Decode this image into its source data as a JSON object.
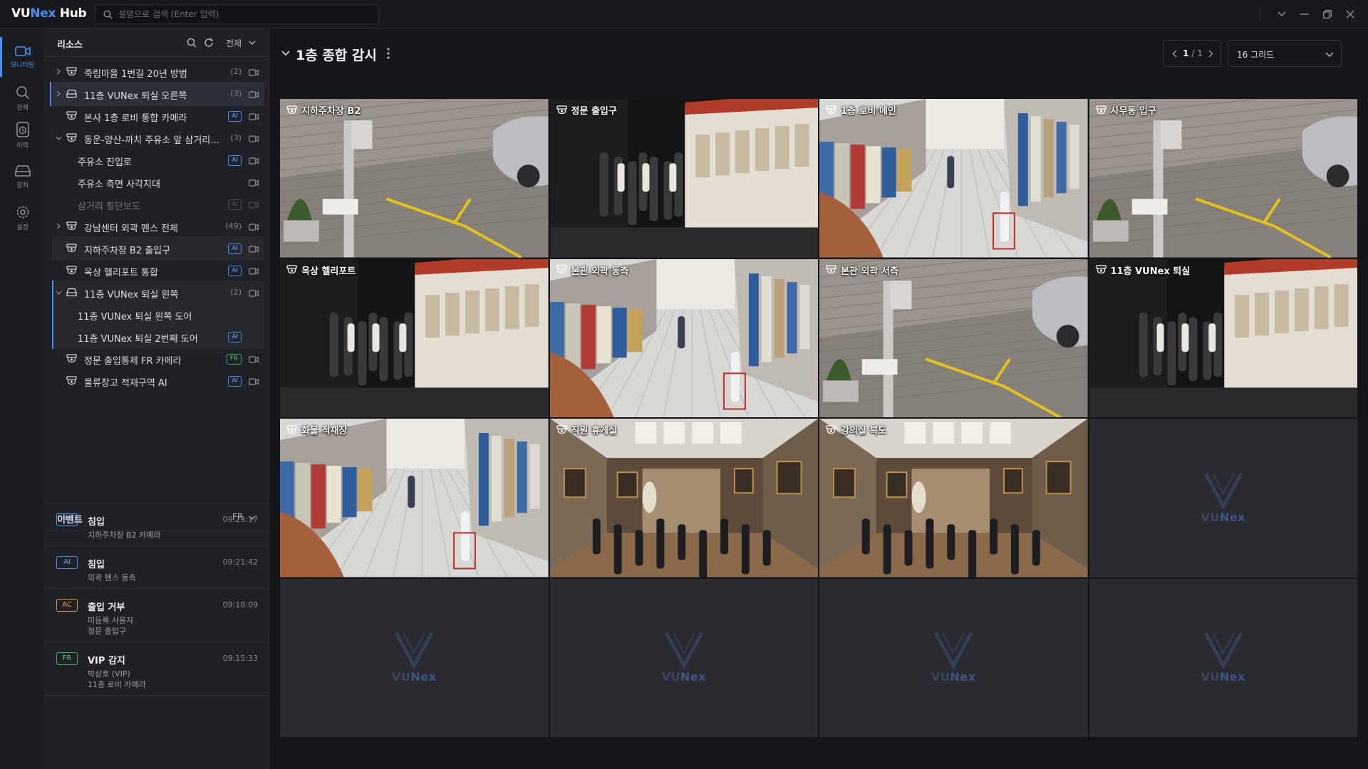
{
  "app": {
    "logo_vu": "VU",
    "logo_nex": "Nex",
    "logo_hub": " Hub"
  },
  "search": {
    "placeholder": "설명으로 검색 (Enter 입력)"
  },
  "rail": [
    {
      "label": "모니터링",
      "icon": "camera-icon",
      "active": true
    },
    {
      "label": "검색",
      "icon": "search-icon"
    },
    {
      "label": "이력",
      "icon": "history-icon"
    },
    {
      "label": "장치",
      "icon": "device-icon"
    },
    {
      "label": "설정",
      "icon": "settings-icon"
    }
  ],
  "resources": {
    "title": "리소스",
    "filter": "전체",
    "items": [
      {
        "label": "죽림마을 1번길 20년 방범",
        "count": "(2)",
        "chev": "right"
      },
      {
        "label": "11층 VUNex 퇴실 오른쪽",
        "count": "(3)",
        "chev": "right"
      },
      {
        "label": "본사 1층 로비 통합 카메라",
        "badge": "AI"
      },
      {
        "label": "동운-양산-까치 주유소 앞 삼거리...",
        "count": "(3)",
        "chev": "down"
      },
      {
        "label": "주유소 진입로",
        "badge": "AI"
      },
      {
        "label": "주유소 측면 사각지대"
      },
      {
        "label": "삼거리 횡단보도",
        "badge": "AI"
      },
      {
        "label": "강남센터 외곽 펜스 전체",
        "count": "(49)",
        "chev": "right"
      },
      {
        "label": "지하주차장 B2 출입구",
        "badge": "AI"
      },
      {
        "label": "옥상 헬리포트 통합",
        "badge": "AI"
      },
      {
        "label": "11층 VUNex 퇴실 왼쪽",
        "count": "(2)",
        "chev": "down"
      },
      {
        "label": "11층 VUNex 퇴실 왼쪽 도어"
      },
      {
        "label": "11층 VUNex 퇴실 2번째 도어",
        "badge": "AI"
      },
      {
        "label": "정문 출입통제 FR 카메라",
        "badge": "FR"
      },
      {
        "label": "물류창고 적재구역 AI",
        "badge": "AI"
      }
    ]
  },
  "events": {
    "title": "이벤트",
    "filter": "FR",
    "items": [
      {
        "tag": "AI",
        "title": "침입",
        "time": "09:23:17",
        "lines": [
          "지하주차장 B2 카메라"
        ]
      },
      {
        "tag": "AI",
        "title": "침입",
        "time": "09:21:42",
        "lines": [
          "외곽 펜스 동측"
        ]
      },
      {
        "tag": "AC",
        "title": "출입 거부",
        "time": "09:18:09",
        "lines": [
          "미등록 사용자",
          "정문 출입구"
        ]
      },
      {
        "tag": "FR",
        "title": "VIP 감지",
        "time": "09:15:33",
        "lines": [
          "박상호 (VIP)",
          "11층 로비 카메라"
        ]
      }
    ]
  },
  "main": {
    "title": "1층 종합 감시",
    "page_current": "1",
    "page_total": "/ 1",
    "grid_select": "16 그리드"
  },
  "tiles": [
    {
      "label": "지하주차장 B2",
      "scene": "parking"
    },
    {
      "label": "정문 출입구",
      "scene": "gallery_dark"
    },
    {
      "label": "1층 로비 메인",
      "scene": "store"
    },
    {
      "label": "사무동 입구",
      "scene": "parking"
    },
    {
      "label": "옥상 헬리포트",
      "scene": "gallery_dark"
    },
    {
      "label": "본관 외곽 동측",
      "scene": "store"
    },
    {
      "label": "본관 외곽 서측",
      "scene": "parking"
    },
    {
      "label": "11층 VUNex 퇴실",
      "scene": "gallery_dark"
    },
    {
      "label": "화물 적재장",
      "scene": "store"
    },
    {
      "label": "직원 휴게실",
      "scene": "museum"
    },
    {
      "label": "강의실 복도",
      "scene": "museum"
    },
    {
      "label": "",
      "scene": "empty"
    },
    {
      "label": "",
      "scene": "empty"
    },
    {
      "label": "",
      "scene": "empty"
    },
    {
      "label": "",
      "scene": "empty"
    },
    {
      "label": "",
      "scene": "empty"
    }
  ],
  "watermark": {
    "vu": "VU",
    "nex": "Nex"
  },
  "colors": {
    "accent": "#4b8df0",
    "fr": "#3fae5b",
    "ac": "#d49a2a",
    "bg": "#15161a",
    "panel": "#202126"
  }
}
